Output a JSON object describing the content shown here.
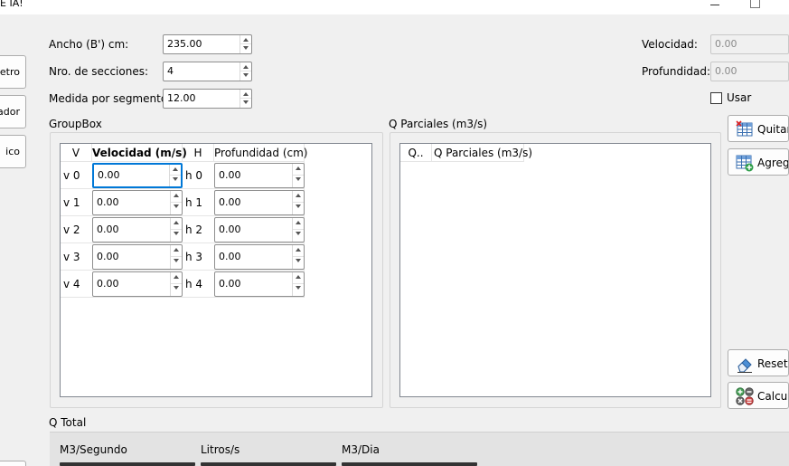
{
  "window": {
    "title": "E IA!"
  },
  "side_buttons": [
    "etro",
    "ador",
    "ico"
  ],
  "params": {
    "ancho_label": "Ancho (B') cm:",
    "ancho_value": "235.00",
    "secciones_label": "Nro. de secciones:",
    "secciones_value": "4",
    "segmento_label": "Medida por segmento:",
    "segmento_value": "12.00"
  },
  "right_params": {
    "velocidad_label": "Velocidad:",
    "velocidad_value": "0.00",
    "profundidad_label": "Profundidad:",
    "profundidad_value": "0.00",
    "usar_label": "Usar"
  },
  "groupbox": {
    "title": "GroupBox",
    "headers": [
      "V",
      "Velocidad (m/s)",
      "H",
      "Profundidad (cm)"
    ],
    "rows": [
      {
        "v": "v 0",
        "vel": "0.00",
        "h": "h 0",
        "prof": "0.00"
      },
      {
        "v": "v 1",
        "vel": "0.00",
        "h": "h 1",
        "prof": "0.00"
      },
      {
        "v": "v 2",
        "vel": "0.00",
        "h": "h 2",
        "prof": "0.00"
      },
      {
        "v": "v 3",
        "vel": "0.00",
        "h": "h 3",
        "prof": "0.00"
      },
      {
        "v": "v 4",
        "vel": "0.00",
        "h": "h 4",
        "prof": "0.00"
      }
    ]
  },
  "parciales": {
    "title": "Q Parciales (m3/s)",
    "headers": [
      "Q..",
      "Q Parciales (m3/s)"
    ]
  },
  "buttons": {
    "quitar": "Quitar",
    "agregar": "Agrega",
    "reset": "Reset",
    "calcular": "Calcula"
  },
  "qtotal": {
    "title": "Q Total",
    "m3_segundo": "M3/Segundo",
    "litros": "Litros/s",
    "m3_dia": "M3/Dia"
  }
}
